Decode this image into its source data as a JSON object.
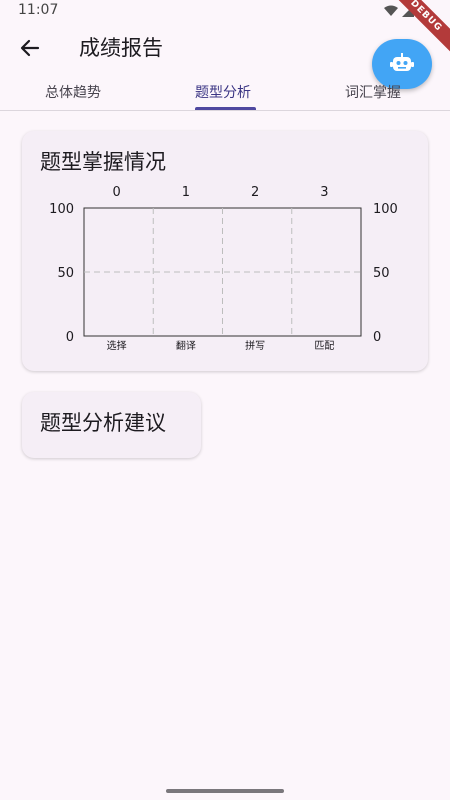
{
  "status_bar": {
    "time": "11:07",
    "debug_label": "DEBUG"
  },
  "app_bar": {
    "title": "成绩报告"
  },
  "tabs": [
    {
      "label": "总体趋势",
      "active": false
    },
    {
      "label": "题型分析",
      "active": true
    },
    {
      "label": "词汇掌握",
      "active": false
    }
  ],
  "chart_card": {
    "title": "题型掌握情况"
  },
  "advice_card": {
    "title": "题型分析建议"
  },
  "chart_data": {
    "type": "bar",
    "title": "",
    "categories": [
      "选择",
      "翻译",
      "拼写",
      "匹配"
    ],
    "top_axis_labels": [
      "0",
      "1",
      "2",
      "3"
    ],
    "values": [],
    "ylim": [
      0,
      100
    ],
    "y_ticks": [
      "0",
      "50",
      "100"
    ],
    "grid": true
  },
  "colors": {
    "accent": "#4f48a0",
    "fab": "#42a5f5",
    "background": "#fcf6fb",
    "card": "#f5eef6"
  },
  "icons": {
    "back": "arrow-left-icon",
    "fab": "robot-icon"
  }
}
